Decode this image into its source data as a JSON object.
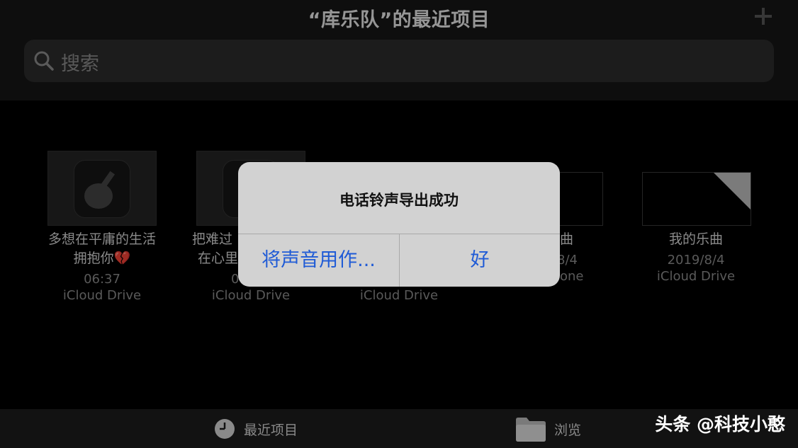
{
  "header": {
    "title": "“库乐队”的最近项目",
    "add_icon": "plus-icon",
    "search": {
      "placeholder": "搜索",
      "icon": "search-icon"
    }
  },
  "projects": [
    {
      "name_line1": "多想在平庸的生活",
      "name_line2": "拥抱你💔",
      "time": "06:37",
      "location": "iCloud Drive",
      "icon": "guitar-icon"
    },
    {
      "name_line1": "把难过",
      "name_line2": "在心里",
      "time": "0",
      "location": "iCloud Drive",
      "icon": "guitar-icon"
    },
    {
      "location": "iCloud Drive"
    },
    {
      "name": "曲",
      "date": "8/4",
      "location": "one"
    },
    {
      "name": "我的乐曲",
      "date": "2019/8/4",
      "location": "iCloud Drive"
    }
  ],
  "alert": {
    "title": "电话铃声导出成功",
    "use_sound_label": "将声音用作...",
    "ok_label": "好"
  },
  "tabbar": {
    "recent_label": "最近项目",
    "recent_icon": "clock-icon",
    "browse_label": "浏览",
    "browse_icon": "folder-icon"
  },
  "watermark": "头条 @科技小憨"
}
